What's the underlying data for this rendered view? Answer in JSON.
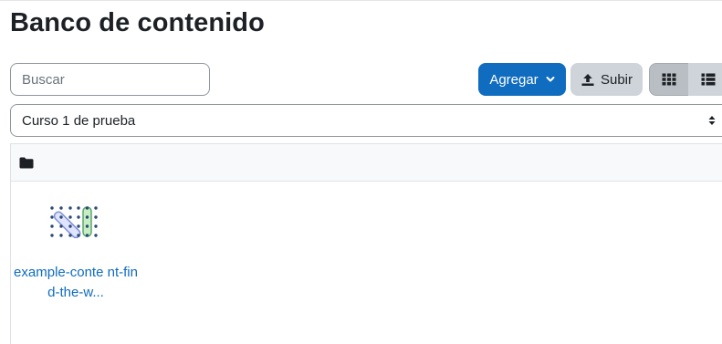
{
  "page": {
    "title": "Banco de contenido"
  },
  "toolbar": {
    "search_placeholder": "Buscar",
    "add_label": "Agregar",
    "upload_label": "Subir",
    "icons": [
      "chevron-down-icon",
      "upload-icon",
      "grid-view-icon",
      "list-view-icon"
    ]
  },
  "context_select": {
    "selected": "Curso 1 de prueba"
  },
  "browser": {
    "header_icon": "folder-icon",
    "files": [
      {
        "name": "example-conte nt-find-the-w...",
        "icon": "find-the-words-icon"
      }
    ]
  },
  "colors": {
    "primary": "#0f6cbf",
    "secondary": "#ced4da",
    "grid_active": "#b9bec4",
    "text": "#1d2125"
  }
}
